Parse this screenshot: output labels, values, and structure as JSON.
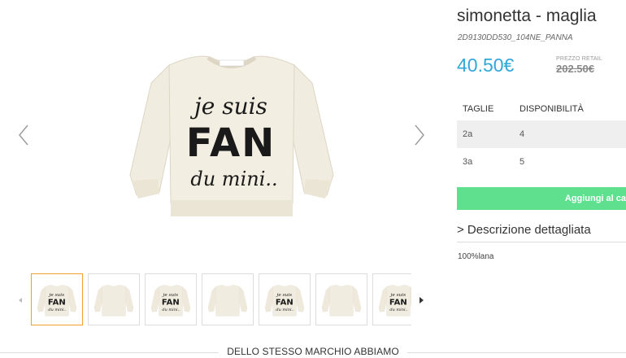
{
  "product": {
    "title": "simonetta - maglia",
    "sku": "2D9130DD530_104NE_PANNA",
    "price": "40.50€",
    "retail_label": "PREZZO RETAIL",
    "retail_price": "202.50€",
    "sweater_text": [
      "je suis",
      "FAN",
      "du mini.."
    ],
    "thumbnail_count": 7,
    "active_thumbnail": 1
  },
  "sizes_table": {
    "headers": [
      "TAGLIE",
      "DISPONIBILITÀ"
    ],
    "rows": [
      {
        "size": "2a",
        "availability": "4"
      },
      {
        "size": "3a",
        "availability": "5"
      }
    ]
  },
  "cart_button": {
    "label": "Aggiungi al ca"
  },
  "description": {
    "toggle_label": "> Descrizione dettagliata",
    "material": "100%lana"
  },
  "section": {
    "title": "DELLO STESSO MARCHIO ABBIAMO"
  },
  "colors": {
    "price": "#2fa8da",
    "cart_button": "#5ee08f",
    "sweater": "#f1ece0",
    "active_thumb_border": "#f0a12b"
  },
  "icons": {
    "gallery_prev": "chevron-left-icon",
    "gallery_next": "chevron-right-icon",
    "thumbs_prev": "caret-left-icon",
    "thumbs_next": "caret-right-icon"
  }
}
